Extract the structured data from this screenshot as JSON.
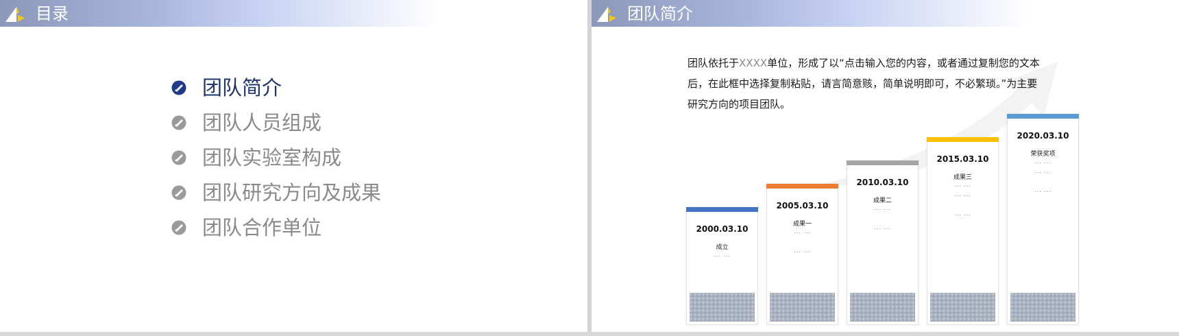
{
  "left_slide": {
    "header_title": "目录",
    "toc": [
      {
        "label": "团队简介",
        "active": true
      },
      {
        "label": "团队人员组成",
        "active": false
      },
      {
        "label": "团队实验室构成",
        "active": false
      },
      {
        "label": "团队研究方向及成果",
        "active": false
      },
      {
        "label": "团队合作单位",
        "active": false
      }
    ]
  },
  "right_slide": {
    "header_title": "团队简介",
    "intro_prefix": "团队依托于",
    "intro_placeholder": "XXXX",
    "intro_suffix": "单位，形成了以“点击输入您的内容，或者通过复制您的文本后，在此框中选择复制粘贴，请言简意赅，简单说明即可，不必繁琐。”为主要研究方向的项目团队。",
    "timeline": [
      {
        "date": "2000.03.10",
        "result": "成立",
        "dots": [
          "... ..."
        ],
        "color": "#4472c4"
      },
      {
        "date": "2005.03.10",
        "result": "成果一",
        "dots": [
          "... ...",
          "... ..."
        ],
        "color": "#ed7d31"
      },
      {
        "date": "2010.03.10",
        "result": "成果二",
        "dots": [
          "... ...",
          "... ..."
        ],
        "color": "#a5a5a5"
      },
      {
        "date": "2015.03.10",
        "result": "成果三",
        "dots": [
          "... ...",
          "... ...",
          "... ..."
        ],
        "color": "#ffc000"
      },
      {
        "date": "2020.03.10",
        "result": "荣获奖项",
        "dots": [
          "... ...",
          "... ...",
          "... ..."
        ],
        "color": "#5b9bd5"
      }
    ]
  },
  "colors": {
    "active_text": "#1f3471",
    "inactive_text": "#8a8a8a",
    "active_bullet": "#1f3a8a",
    "inactive_bullet": "#9a9a9a"
  }
}
